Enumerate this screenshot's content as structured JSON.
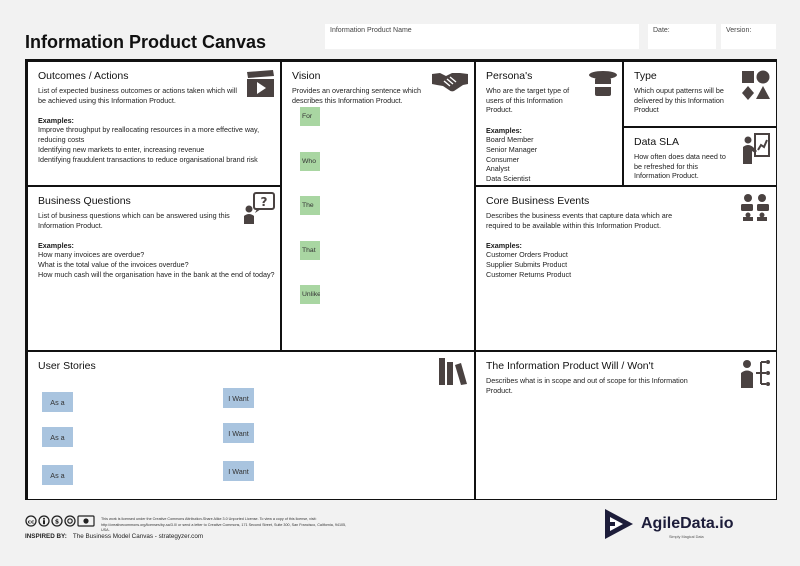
{
  "header": {
    "title": "Information Product Canvas",
    "name_label": "Information Product Name",
    "date_label": "Date:",
    "version_label": "Version:"
  },
  "outcomes": {
    "title": "Outcomes / Actions",
    "desc": "List of expected business outcomes or actions taken which will be achieved using this Information Product.",
    "examples_label": "Examples:",
    "examples": [
      "Improve throughput by reallocating resources in a more effective way, reducing costs",
      "Identifying new markets to enter, increasing revenue",
      "Identifying fraudulent transactions to reduce organisational brand risk"
    ]
  },
  "questions": {
    "title": "Business Questions",
    "desc": "List of business questions which can be answered using this Information Product.",
    "examples_label": "Examples:",
    "examples": [
      "How many invoices are overdue?",
      "What is the total value of the invoices overdue?",
      "How much cash will the organisation have in the bank at the end of today?"
    ]
  },
  "vision": {
    "title": "Vision",
    "desc": "Provides an overarching sentence which describes this Information Product.",
    "stickies": [
      "For",
      "Who",
      "The",
      "That",
      "Unlike"
    ]
  },
  "personas": {
    "title": "Persona's",
    "desc": "Who are the target type of users of this Information Product.",
    "examples_label": "Examples:",
    "examples": [
      "Board Member",
      "Senior Manager",
      "Consumer",
      "Analyst",
      "Data Scientist"
    ]
  },
  "type": {
    "title": "Type",
    "desc": "Which ouput patterns will be delivered by this Information Product"
  },
  "sla": {
    "title": "Data SLA",
    "desc": "How often does data need to be refreshed for this Information Product."
  },
  "events": {
    "title": "Core Business Events",
    "desc": "Describes the business events that capture data which are required to be available within this Information Product.",
    "examples_label": "Examples:",
    "examples": [
      "Customer Orders Product",
      "Supplier Submits Product",
      "Customer Returns Product"
    ]
  },
  "stories": {
    "title": "User Stories",
    "as_a": [
      "As a",
      "As a",
      "As a"
    ],
    "i_want": [
      "I Want",
      "I Want",
      "I Want"
    ]
  },
  "scope": {
    "title": "The Information Product Will / Won't",
    "desc": "Describes what is in scope and out of scope for this Information Product."
  },
  "footer": {
    "license": "This work is licensed under the Creative Commons Attribution-Share Alike 3.0 Unported License. To view a copy of this license, visit: http://creativecommons.org/licenses/by-sa/3.0/ or send a letter to Creative Commons, 171 Second Street, Suite 300, San Francisco, California, 94105, USA.",
    "inspired_label": "INSPIRED BY:",
    "inspired_text": "The Business Model Canvas - strategyzer.com",
    "brand": "AgileData.io",
    "brand_tagline": "Simply Magical Data"
  },
  "colors": {
    "vision_sticky": "#a9d6a2",
    "story_sticky": "#a9c4df",
    "brand": "#1d1d3a",
    "icon": "#4a4241"
  }
}
